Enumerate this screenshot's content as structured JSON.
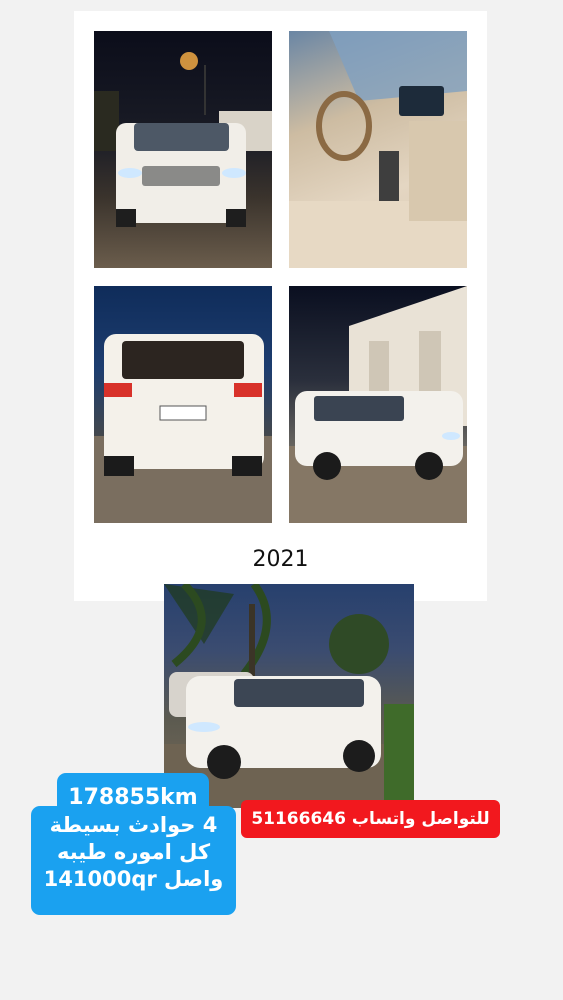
{
  "collage": {
    "photos": [
      {
        "alt": "front-view-night"
      },
      {
        "alt": "interior-dashboard"
      },
      {
        "alt": "rear-view"
      },
      {
        "alt": "side-view-palace"
      }
    ],
    "year_label": "2021"
  },
  "hero_photo": {
    "alt": "suv-under-palm-trees"
  },
  "listing": {
    "mileage": "178855km",
    "accidents": "4 حوادث بسيطة",
    "condition": "كل اموره طيبه",
    "price": "واصل 141000qr",
    "contact": "للتواصل واتساب 51166646"
  },
  "colors": {
    "blue_tag": "#1aa1f0",
    "red_tag": "#f2181e",
    "car_white": "#f3f1ec"
  }
}
